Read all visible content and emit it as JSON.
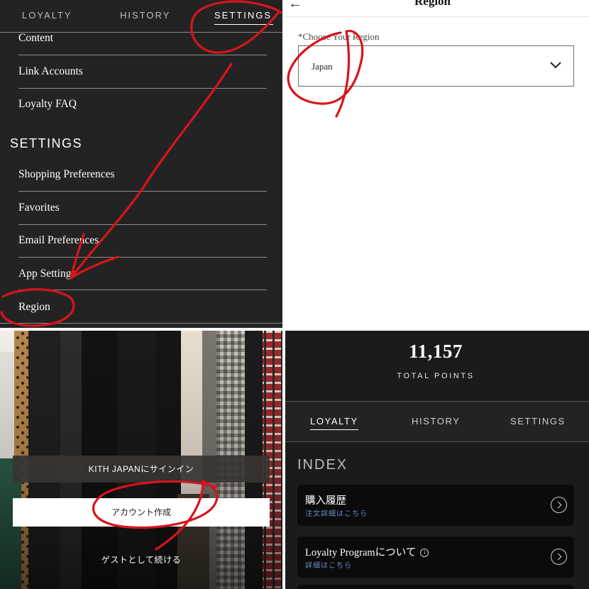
{
  "settings_panel": {
    "tabs": [
      {
        "label": "LOYALTY",
        "active": false
      },
      {
        "label": "HISTORY",
        "active": false
      },
      {
        "label": "SETTINGS",
        "active": true
      }
    ],
    "top_items": [
      "Content",
      "Link Accounts",
      "Loyalty FAQ"
    ],
    "section_title": "SETTINGS",
    "settings_items": [
      "Shopping Preferences",
      "Favorites",
      "Email Preferences",
      "App Settings",
      "Region"
    ]
  },
  "region_panel": {
    "title": "Region",
    "back_icon": "arrow-left-icon",
    "field_label": "*Choose Your Region",
    "selected_value": "Japan",
    "dropdown_icon": "chevron-down-icon"
  },
  "signin_panel": {
    "signin_button": "KITH JAPANにサインイン",
    "create_account_button": "アカウント作成",
    "guest_link": "ゲストとして続ける"
  },
  "loyalty_panel": {
    "points_value": "11,157",
    "points_label": "TOTAL POINTS",
    "tabs": [
      {
        "label": "LOYALTY",
        "active": true
      },
      {
        "label": "HISTORY",
        "active": false
      },
      {
        "label": "SETTINGS",
        "active": false
      }
    ],
    "index_title": "INDEX",
    "cards": [
      {
        "title": "購入履歴",
        "subtitle": "注文詳細はこちら",
        "info_icon": false
      },
      {
        "title": "Loyalty Programについて",
        "subtitle": "詳細はこちら",
        "info_icon": true
      }
    ]
  },
  "colors": {
    "dark_bg": "#232323",
    "loyalty_bg": "#1b1b1b",
    "card_bg": "#0b0b0b",
    "link_blue": "#6f8cc7",
    "annotation_red": "#d9141b"
  }
}
